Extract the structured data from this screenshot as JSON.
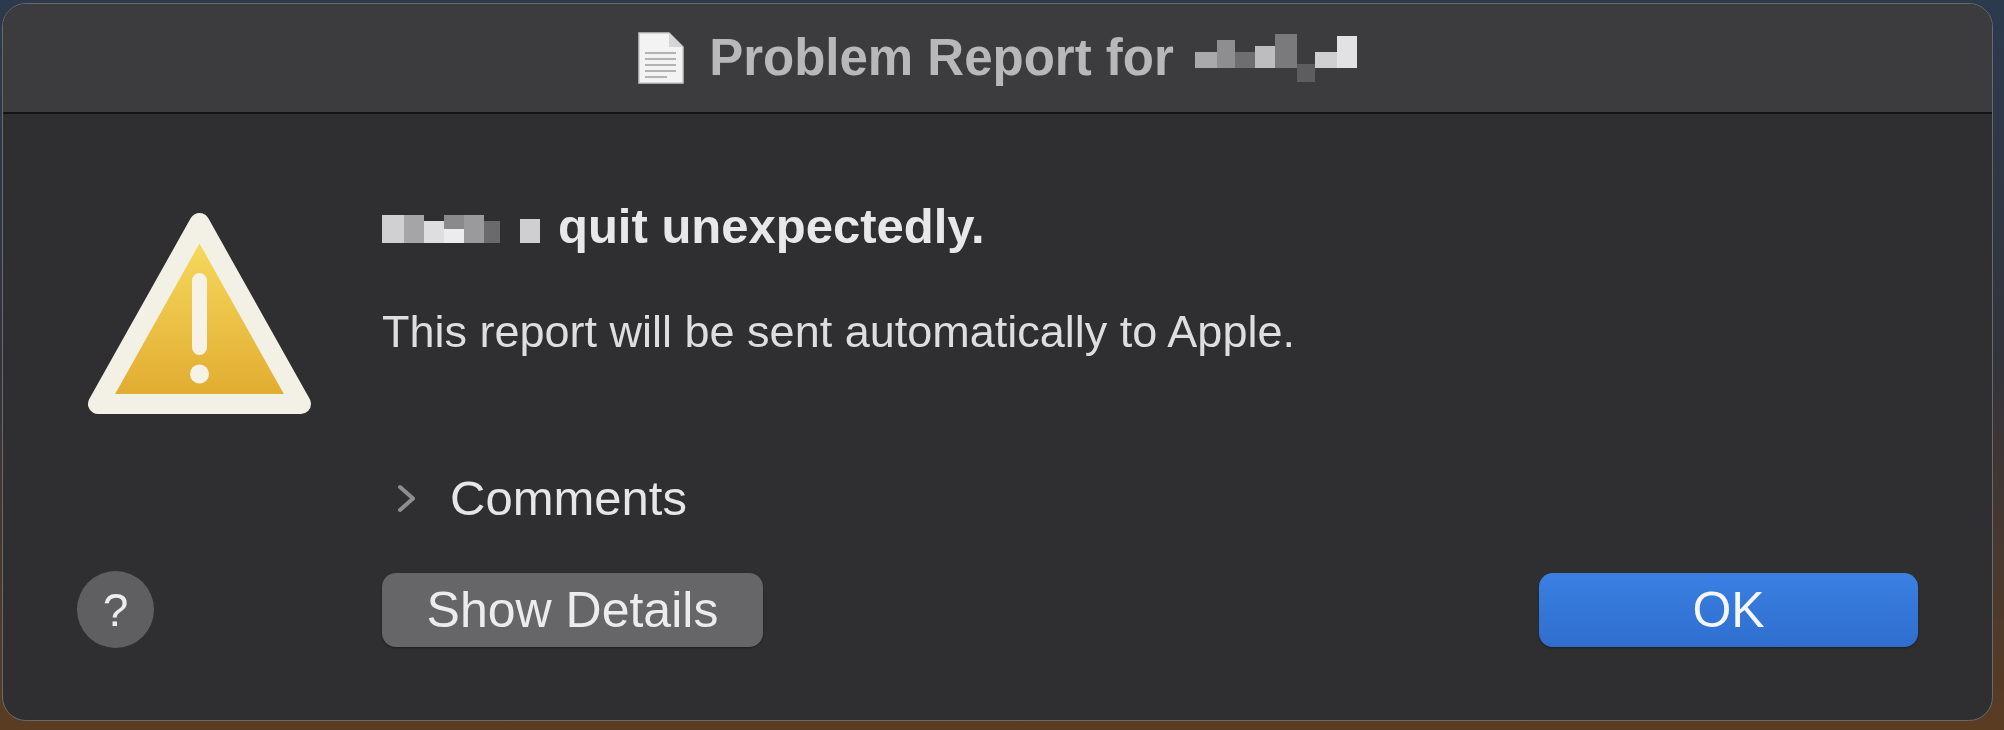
{
  "window": {
    "title": "Problem Report for",
    "title_redacted": true
  },
  "alert": {
    "heading": "quit unexpectedly.",
    "heading_redacted": true,
    "message": "This report will be sent automatically to Apple."
  },
  "comments": {
    "label": "Comments",
    "expanded": false
  },
  "buttons": [
    {
      "label": "?",
      "kind": "help"
    },
    {
      "label": "Show Details",
      "kind": "secondary"
    },
    {
      "label": "OK",
      "kind": "default"
    }
  ]
}
